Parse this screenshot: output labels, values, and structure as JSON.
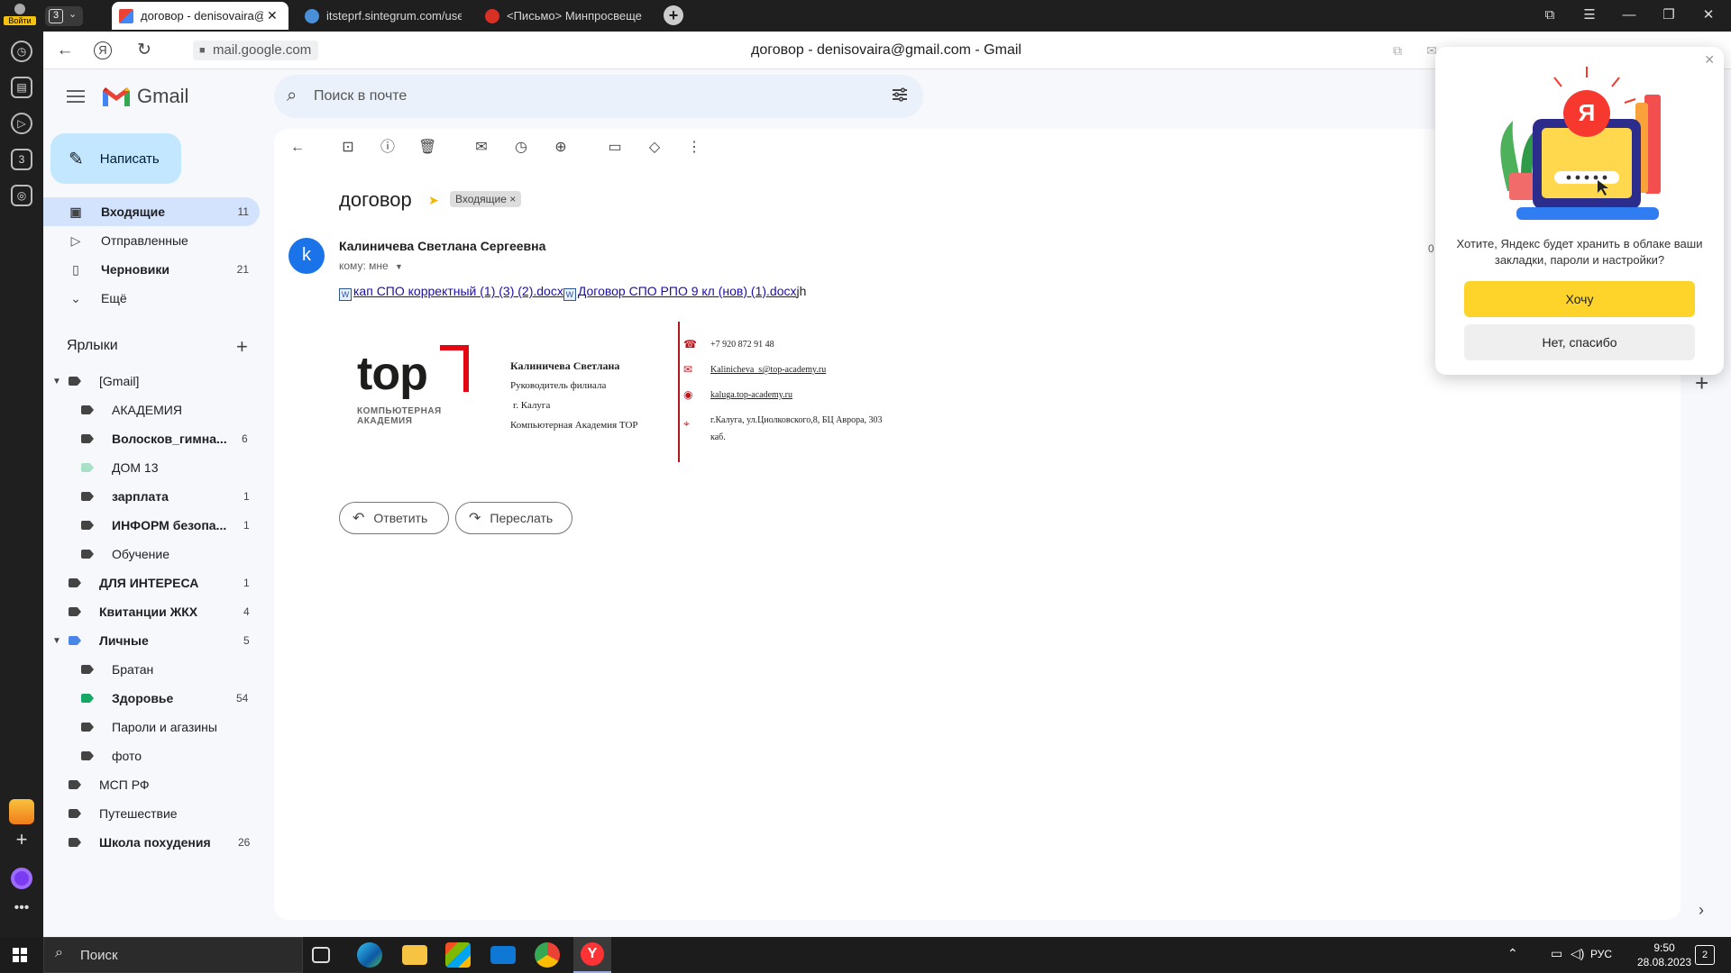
{
  "browser": {
    "profile_label": "Войти",
    "tab_count": "3",
    "tabs": [
      {
        "label": "договор - denisovaira@"
      },
      {
        "label": "itsteprf.sintegrum.com/use"
      },
      {
        "label": "<Письмо> Минпросвеще"
      }
    ],
    "url": "mail.google.com",
    "page_title": "договор - denisovaira@gmail.com - Gmail"
  },
  "gmail": {
    "logo_text": "Gmail",
    "search_placeholder": "Поиск в почте",
    "compose_label": "Написать",
    "nav": [
      {
        "label": "Входящие",
        "count": "11"
      },
      {
        "label": "Отправленные",
        "count": ""
      },
      {
        "label": "Черновики",
        "count": "21"
      },
      {
        "label": "Ещё",
        "count": ""
      }
    ],
    "labels_title": "Ярлыки",
    "labels": [
      {
        "label": "[Gmail]",
        "count": ""
      },
      {
        "label": "АКАДЕМИЯ",
        "count": ""
      },
      {
        "label": "Волосков_гимна...",
        "count": "6"
      },
      {
        "label": "ДОМ 13",
        "count": ""
      },
      {
        "label": "зарплата",
        "count": "1"
      },
      {
        "label": "ИНФОРМ безопа...",
        "count": "1"
      },
      {
        "label": "Обучение",
        "count": ""
      },
      {
        "label": "ДЛЯ ИНТЕРЕСА",
        "count": "1"
      },
      {
        "label": "Квитанции ЖКХ",
        "count": "4"
      },
      {
        "label": "Личные",
        "count": "5"
      },
      {
        "label": "Братан",
        "count": ""
      },
      {
        "label": "Здоровье",
        "count": "54"
      },
      {
        "label": "Пароли и агазины",
        "count": ""
      },
      {
        "label": "фото",
        "count": ""
      },
      {
        "label": "МСП РФ",
        "count": ""
      },
      {
        "label": "Путешествие",
        "count": ""
      },
      {
        "label": "Школа похудения",
        "count": "26"
      }
    ]
  },
  "message": {
    "subject": "договор",
    "inbox_chip": "Входящие ×",
    "avatar_letter": "k",
    "sender": "Калиничева Светлана Сергеевна",
    "to": "кому: мне",
    "attachment1": "кап СПО корректный (1) (3) (2).docx",
    "attachment2": "Договор СПО РПО 9 кл (нов) (1).docx",
    "trailing_text": "jh",
    "partial_date": "0",
    "signature": {
      "logo_word": "top",
      "logo_sub1": "КОМПЬЮТЕРНАЯ",
      "logo_sub2": "АКАДЕМИЯ",
      "name": "Калиничева Светлана",
      "position": "Руководитель филиала",
      "city": "г. Калуга",
      "company": "Компьютерная Академия TOP",
      "phone": "+7 920 872 91 48",
      "email": "Kalinicheva_s@top-academy.ru",
      "site": "kaluga.top-academy.ru",
      "address1": "г.Калуга, ул.Циолковского,8, БЦ Аврора, 303",
      "address2": "каб."
    },
    "reply_label": "Ответить",
    "forward_label": "Переслать"
  },
  "yandex_popup": {
    "logo_letter": "Я",
    "question": "Хотите, Яндекс будет хранить в облаке ваши закладки, пароли и настройки?",
    "yes_label": "Хочу",
    "no_label": "Нет, спасибо"
  },
  "taskbar": {
    "search_label": "Поиск",
    "lang": "РУС",
    "time": "9:50",
    "date": "28.08.2023",
    "notifications": "2"
  }
}
